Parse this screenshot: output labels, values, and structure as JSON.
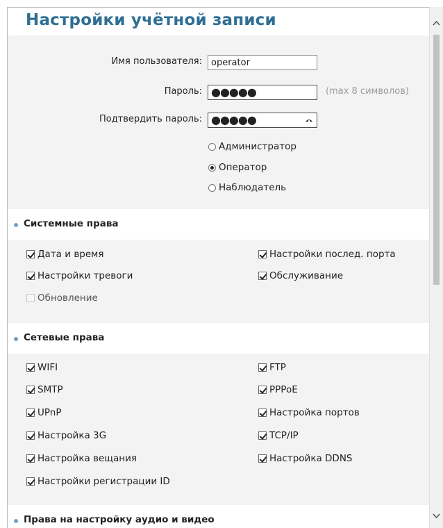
{
  "title": "Настройки учётной записи",
  "account": {
    "username_label": "Имя пользователя:",
    "username_value": "operator",
    "password_label": "Пароль:",
    "password_mask": "●●●●●",
    "password_hint": "(max 8 символов)",
    "confirm_label": "Подтвердить пароль:",
    "confirm_mask": "●●●●●"
  },
  "roles": [
    {
      "label": "Администратор",
      "selected": false
    },
    {
      "label": "Оператор",
      "selected": true
    },
    {
      "label": "Наблюдатель",
      "selected": false
    }
  ],
  "system_rights": {
    "heading": "Системные права",
    "items": [
      {
        "label": "Дата и время",
        "checked": true,
        "enabled": true
      },
      {
        "label": "Настройки послед. порта",
        "checked": true,
        "enabled": true
      },
      {
        "label": "Настройки тревоги",
        "checked": true,
        "enabled": true
      },
      {
        "label": "Обслуживание",
        "checked": true,
        "enabled": true
      },
      {
        "label": "Обновление",
        "checked": false,
        "enabled": false
      }
    ]
  },
  "network_rights": {
    "heading": "Сетевые права",
    "items": [
      {
        "label": "WIFI",
        "checked": true
      },
      {
        "label": "FTP",
        "checked": true
      },
      {
        "label": "SMTP",
        "checked": true
      },
      {
        "label": "PPPoE",
        "checked": true
      },
      {
        "label": "UPnP",
        "checked": true
      },
      {
        "label": "Настройка портов",
        "checked": true
      },
      {
        "label": "Настройка 3G",
        "checked": true
      },
      {
        "label": "TCP/IP",
        "checked": true
      },
      {
        "label": "Настройка вещания",
        "checked": true
      },
      {
        "label": "Настройка DDNS",
        "checked": true
      },
      {
        "label": "Настройки регистрации ID",
        "checked": true
      }
    ]
  },
  "av_rights": {
    "heading": "Права на настройку аудио и видео"
  },
  "colors": {
    "title": "#2f6f93",
    "panel": "#f3f3f3",
    "bullet": "#7b9fbd"
  }
}
